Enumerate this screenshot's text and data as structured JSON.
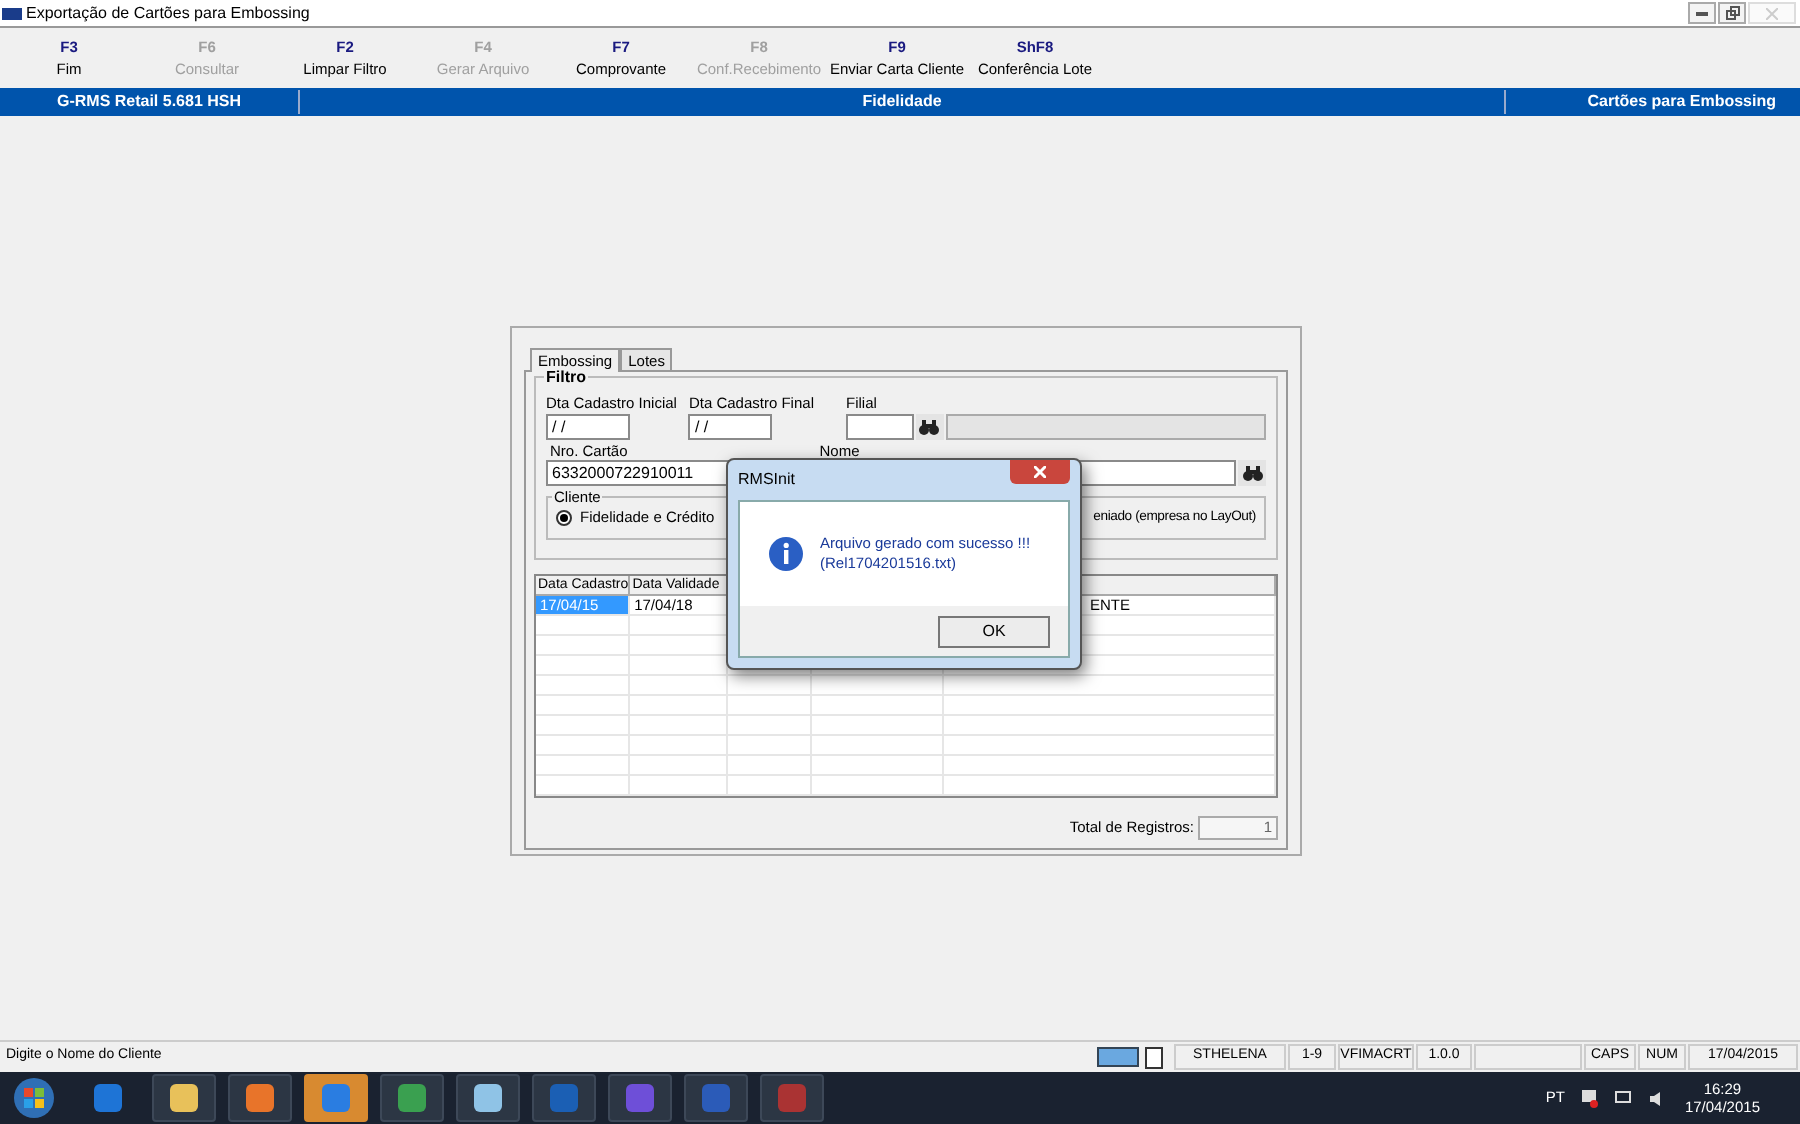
{
  "window": {
    "title": "Exportação de Cartões para Embossing"
  },
  "toolbar": [
    {
      "key": "F3",
      "label": "Fim",
      "disabled": false
    },
    {
      "key": "F6",
      "label": "Consultar",
      "disabled": true
    },
    {
      "key": "F2",
      "label": "Limpar Filtro",
      "disabled": false
    },
    {
      "key": "F4",
      "label": "Gerar Arquivo",
      "disabled": true
    },
    {
      "key": "F7",
      "label": "Comprovante",
      "disabled": false
    },
    {
      "key": "F8",
      "label": "Conf.Recebimento",
      "disabled": true
    },
    {
      "key": "F9",
      "label": "Enviar Carta Cliente",
      "disabled": false
    },
    {
      "key": "ShF8",
      "label": "Conferência Lote",
      "disabled": false
    }
  ],
  "header": [
    "G-RMS Retail 5.681 HSH",
    "Fidelidade",
    "Cartões para Embossing"
  ],
  "tabs": [
    {
      "label": "Embossing",
      "selected": true
    },
    {
      "label": "Lotes",
      "selected": false
    }
  ],
  "filter": {
    "title": "Filtro",
    "date_start": {
      "label": "Dta Cadastro Inicial",
      "value": " / /"
    },
    "date_end": {
      "label": "Dta Cadastro Final",
      "value": " / /"
    },
    "branch": {
      "label": "Filial"
    },
    "card": {
      "label": "Nro. Cartão",
      "value": "6332000722910011"
    },
    "name": {
      "label": "Nome"
    },
    "client": {
      "title": "Cliente",
      "options": [
        {
          "label": "Fidelidade e Crédito",
          "selected": true
        },
        {
          "label": "eniado (empresa no LayOut)"
        }
      ]
    }
  },
  "table": {
    "columns": [
      "Data Cadastro",
      "Data Validade"
    ],
    "rows": [
      {
        "selected": true,
        "cells": [
          "17/04/15",
          "17/04/18",
          "",
          "",
          "ENTE"
        ]
      }
    ]
  },
  "total": {
    "label": "Total de Registros:",
    "value": "1"
  },
  "dialog": {
    "title": "RMSInit",
    "message": "Arquivo gerado com sucesso !!!",
    "file": "(Rel1704201516.txt)",
    "button": "OK"
  },
  "status_bar": {
    "hint": "Digite o Nome do Cliente",
    "cells": [
      "STHELENA",
      "1-9",
      "VFIMACRT",
      "1.0.0",
      "",
      "CAPS",
      "NUM",
      "17/04/2015"
    ]
  },
  "taskbar": {
    "language": "PT",
    "time": "16:29",
    "date": "17/04/2015"
  }
}
